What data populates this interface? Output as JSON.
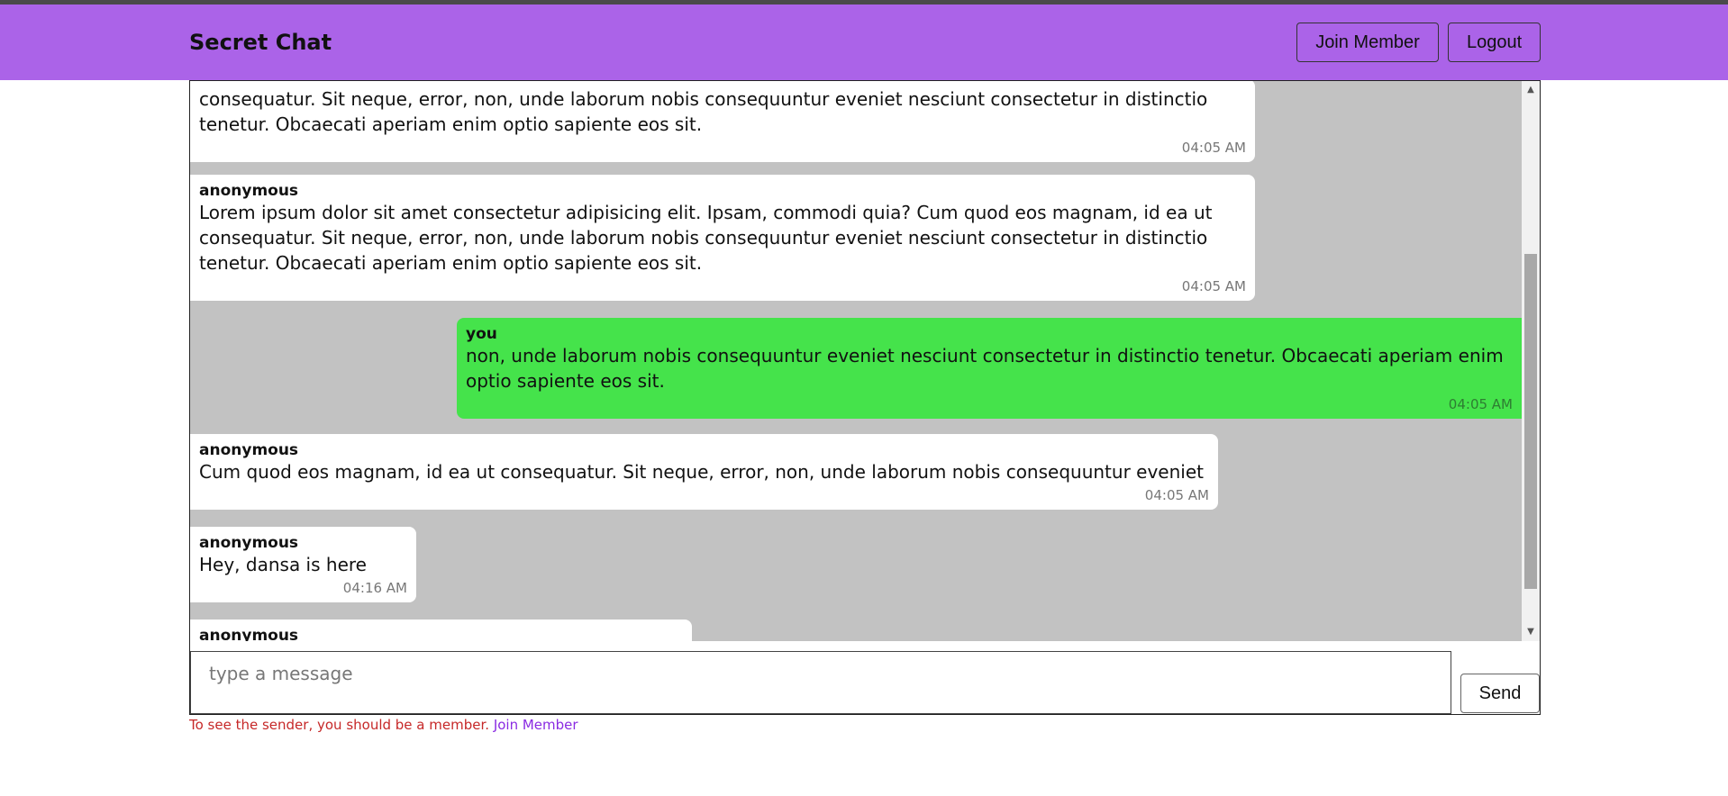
{
  "app": {
    "title": "Secret Chat"
  },
  "nav": {
    "join_label": "Join Member",
    "logout_label": "Logout"
  },
  "messages": [
    {
      "sender": "",
      "text": "consequatur. Sit neque, error, non, unde laborum nobis consequuntur eveniet nesciunt consectetur in distinctio tenetur. Obcaecati aperiam enim optio sapiente eos sit.",
      "time": "04:05 AM",
      "direction": "in"
    },
    {
      "sender": "anonymous",
      "text": "Lorem ipsum dolor sit amet consectetur adipisicing elit. Ipsam, commodi quia? Cum quod eos magnam, id ea ut consequatur. Sit neque, error, non, unde laborum nobis consequuntur eveniet nesciunt consectetur in distinctio tenetur. Obcaecati aperiam enim optio sapiente eos sit.",
      "time": "04:05 AM",
      "direction": "in"
    },
    {
      "sender": "you",
      "text": "non, unde laborum nobis consequuntur eveniet nesciunt consectetur in distinctio tenetur. Obcaecati aperiam enim optio sapiente eos sit.",
      "time": "04:05 AM",
      "direction": "out"
    },
    {
      "sender": "anonymous",
      "text": "Cum quod eos magnam, id ea ut consequatur. Sit neque, error, non, unde laborum nobis consequuntur eveniet",
      "time": "04:05 AM",
      "direction": "in"
    },
    {
      "sender": "anonymous",
      "text": "Hey, dansa is here",
      "time": "04:16 AM",
      "direction": "in"
    },
    {
      "sender": "anonymous",
      "text": "",
      "time": "",
      "direction": "in"
    }
  ],
  "composer": {
    "placeholder": "type a message",
    "send_label": "Send"
  },
  "notice": {
    "text": "To see the sender, you should be a member.",
    "link_label": "Join Member"
  },
  "colors": {
    "navbar": "#ab63e8",
    "outgoing": "#45e34b",
    "incoming": "#ffffff",
    "chat_bg": "#c2c2c2"
  }
}
